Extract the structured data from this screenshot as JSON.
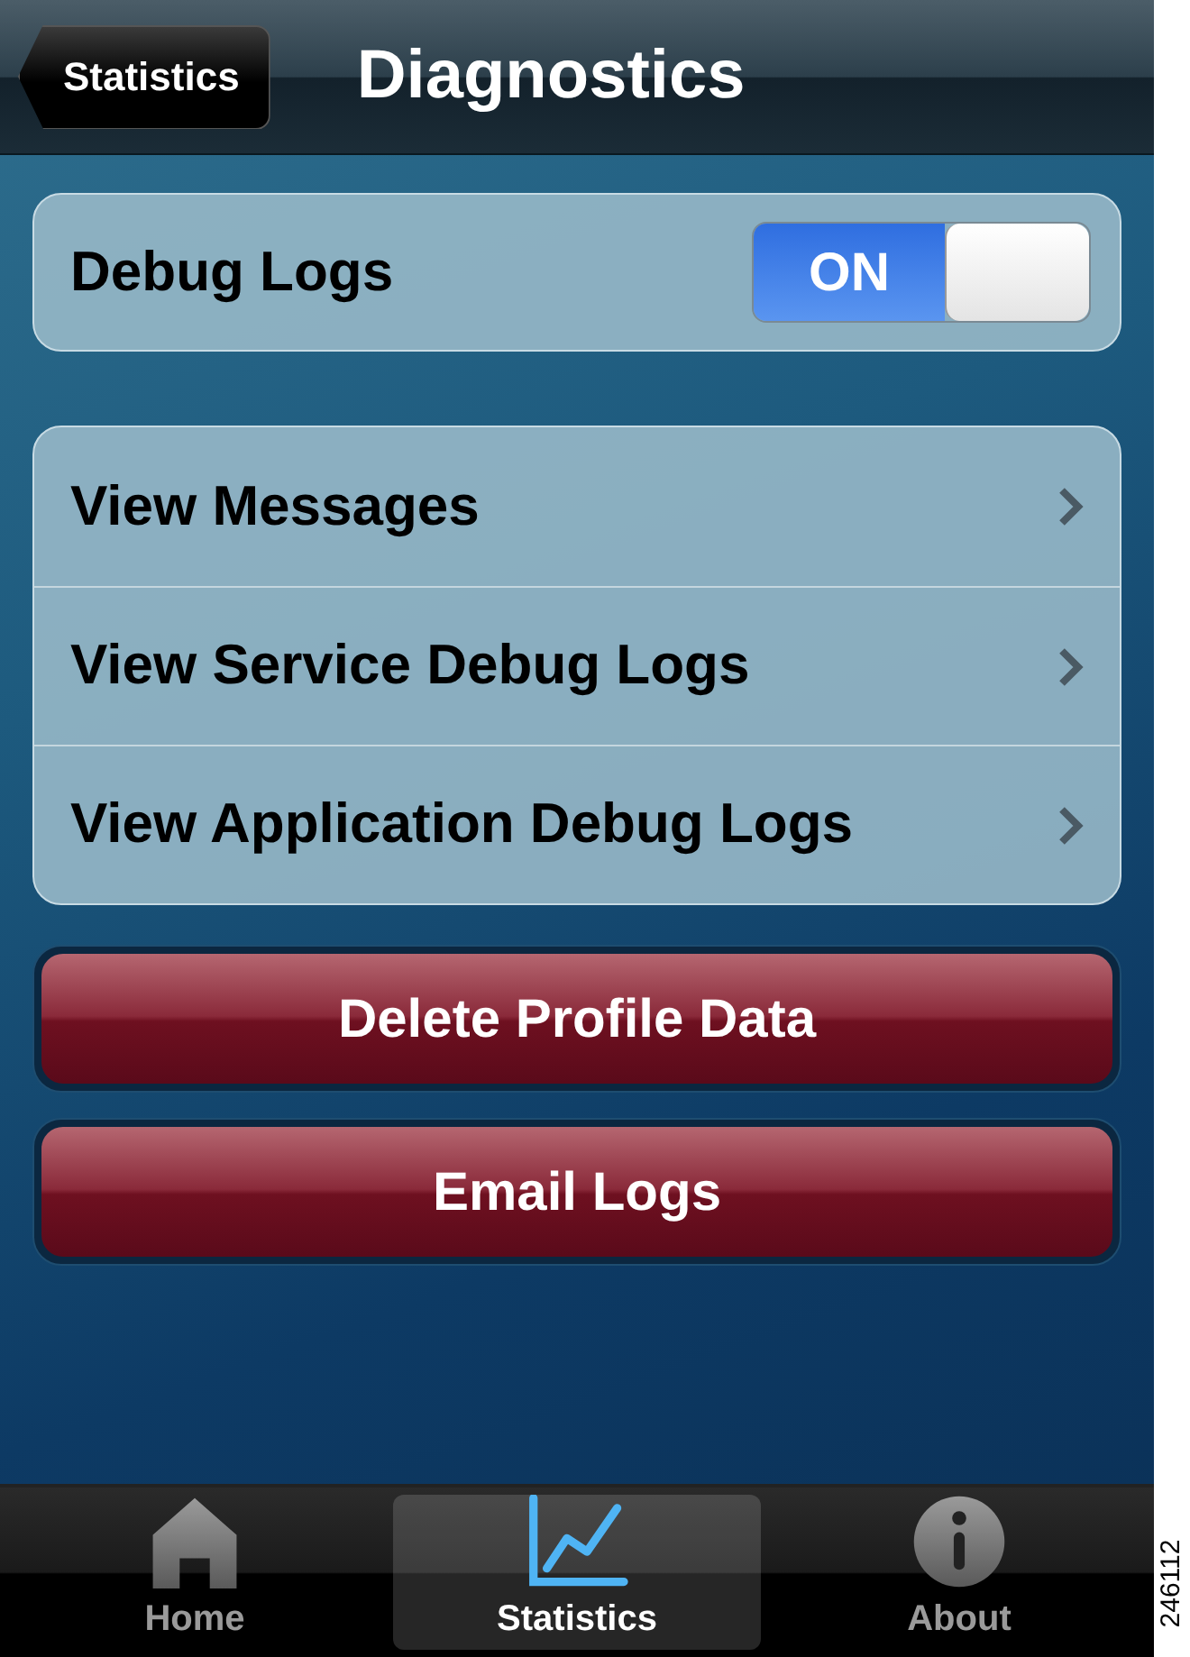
{
  "nav_bar": {
    "back_button": "Statistics",
    "title": "Diagnostics"
  },
  "debug_logs": {
    "label": "Debug Logs",
    "on": true,
    "on_label": "ON"
  },
  "menu_items": [
    {
      "label": "View Messages"
    },
    {
      "label": "View Service Debug Logs"
    },
    {
      "label": "View Application Debug Logs"
    }
  ],
  "buttons": [
    "Delete Profile Data",
    "Email Logs"
  ],
  "tab_bar": [
    {
      "kind": "home",
      "label": "Home",
      "selected": false
    },
    {
      "kind": "statistics",
      "label": "Statistics",
      "selected": true
    },
    {
      "kind": "about",
      "label": "About",
      "selected": false
    }
  ],
  "figure_number": "246112"
}
